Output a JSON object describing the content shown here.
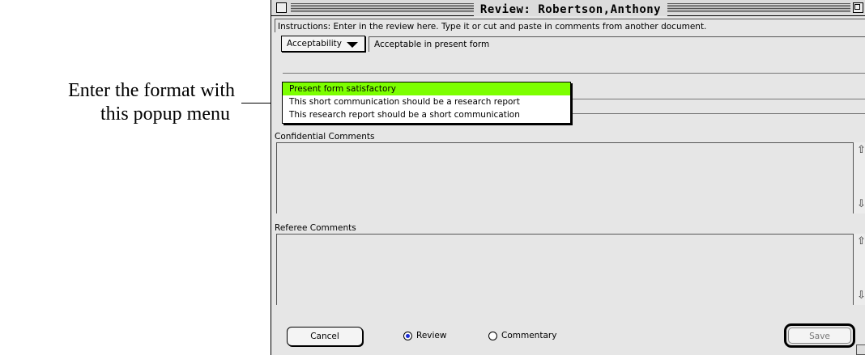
{
  "annotation": {
    "line1": "Enter the format with",
    "line2": "this popup menu"
  },
  "window": {
    "title": "Review: Robertson,Anthony"
  },
  "instructions": "Instructions: Enter in the review here. Type it or cut and paste in comments from another document.",
  "popup": {
    "label": "Acceptability",
    "value": "Acceptable in present form",
    "options": [
      "Present form satisfactory",
      "This short communication should be a research report",
      "This research report should be a short communication"
    ],
    "highlight_color": "#7cff00"
  },
  "confidential": {
    "label": "Confidential Comments",
    "value": ""
  },
  "referee": {
    "label": "Referee Comments",
    "value": ""
  },
  "buttons": {
    "cancel": "Cancel",
    "save": "Save"
  },
  "radios": {
    "review": "Review",
    "commentary": "Commentary",
    "selected": "Review"
  }
}
